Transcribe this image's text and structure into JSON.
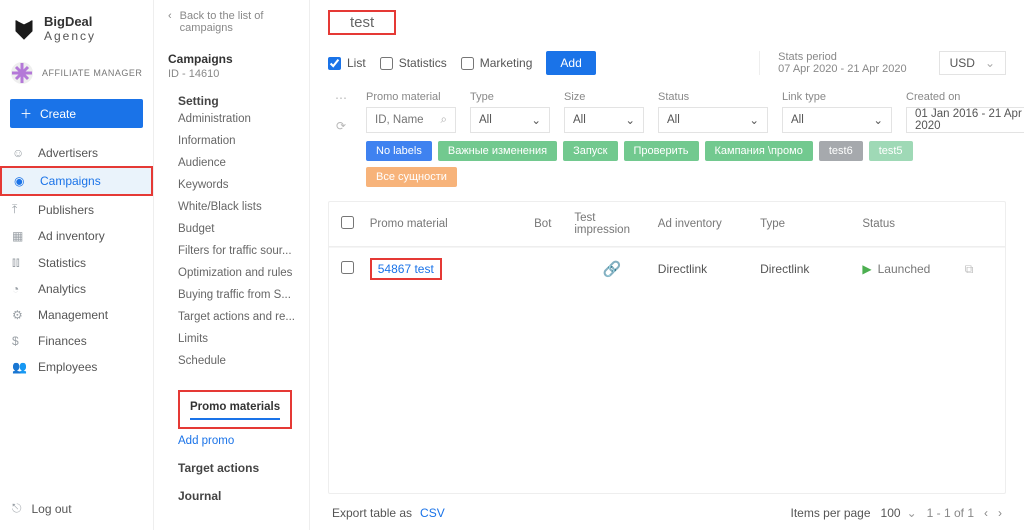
{
  "brand": {
    "line1": "BigDeal",
    "line2": "Agency"
  },
  "manager_label": "AFFILIATE MANAGER",
  "create_label": "Create",
  "nav": [
    {
      "icon": "person",
      "label": "Advertisers"
    },
    {
      "icon": "play",
      "label": "Campaigns"
    },
    {
      "icon": "upload",
      "label": "Publishers"
    },
    {
      "icon": "box",
      "label": "Ad inventory"
    },
    {
      "icon": "bars",
      "label": "Statistics"
    },
    {
      "icon": "pie",
      "label": "Analytics"
    },
    {
      "icon": "gear",
      "label": "Management"
    },
    {
      "icon": "dollar",
      "label": "Finances"
    },
    {
      "icon": "group",
      "label": "Employees"
    }
  ],
  "logout_label": "Log out",
  "back_label": "Back to the list of campaigns",
  "campaigns_heading": "Campaigns",
  "campaign_id_line": "ID - 14610",
  "subnav": {
    "setting_label": "Setting",
    "setting_items": [
      "Administration",
      "Information",
      "Audience",
      "Keywords",
      "White/Black lists",
      "Budget",
      "Filters for traffic sour...",
      "Optimization and rules",
      "Buying traffic from S...",
      "Target actions and re...",
      "Limits",
      "Schedule"
    ],
    "promo_label": "Promo materials",
    "add_promo_label": "Add promo",
    "target_actions_label": "Target actions",
    "journal_label": "Journal"
  },
  "page_title": "test",
  "view_options": {
    "list": "List",
    "statistics": "Statistics",
    "marketing": "Marketing"
  },
  "add_button": "Add",
  "stats_period": {
    "label": "Stats period",
    "range": "07 Apr 2020 - 21 Apr 2020"
  },
  "currency": "USD",
  "filters": {
    "promo_material_label": "Promo material",
    "promo_material_placeholder": "ID, Name",
    "type_label": "Type",
    "type_value": "All",
    "size_label": "Size",
    "size_value": "All",
    "status_label": "Status",
    "status_value": "All",
    "link_type_label": "Link type",
    "link_type_value": "All",
    "created_label": "Created on",
    "created_value": "01 Jan 2016 - 21 Apr 2020"
  },
  "chips": [
    {
      "label": "No labels",
      "bg": "#3f82f0"
    },
    {
      "label": "Важные изменения",
      "bg": "#72c98f"
    },
    {
      "label": "Запуск",
      "bg": "#72c98f"
    },
    {
      "label": "Проверить",
      "bg": "#72c98f"
    },
    {
      "label": "Кампания \\промо",
      "bg": "#72c98f"
    },
    {
      "label": "test6",
      "bg": "#a6a9ad"
    },
    {
      "label": "test5",
      "bg": "#9fd9b6"
    },
    {
      "label": "Все сущности",
      "bg": "#f7b37a"
    }
  ],
  "table": {
    "headers": {
      "promo": "Promo material",
      "bot": "Bot",
      "test_imp": "Test impression",
      "ad_inv": "Ad inventory",
      "type": "Type",
      "status": "Status"
    },
    "rows": [
      {
        "id_name": "54867 test",
        "ad_inv": "Directlink",
        "type": "Directlink",
        "status": "Launched"
      }
    ]
  },
  "footer": {
    "export_label": "Export table as",
    "csv": "CSV",
    "per_page_label": "Items per page",
    "per_page_value": "100",
    "range": "1 - 1 of 1"
  }
}
